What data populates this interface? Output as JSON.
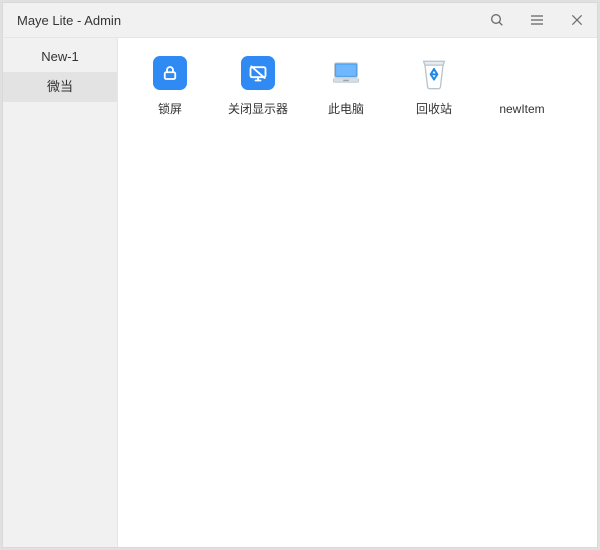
{
  "title": "Maye Lite - Admin",
  "sidebar": {
    "items": [
      {
        "label": "New-1",
        "active": false
      },
      {
        "label": "微当",
        "active": true
      }
    ]
  },
  "apps": [
    {
      "id": "lock-screen",
      "label": "锁屏",
      "icon": "lock-icon"
    },
    {
      "id": "turn-off-display",
      "label": "关闭显示器",
      "icon": "monitor-off-icon"
    },
    {
      "id": "this-pc",
      "label": "此电脑",
      "icon": "this-pc-icon"
    },
    {
      "id": "recycle-bin",
      "label": "回收站",
      "icon": "recycle-bin-icon"
    },
    {
      "id": "new-item",
      "label": "newItem",
      "icon": "none"
    }
  ],
  "colors": {
    "accent": "#2f8af3"
  }
}
